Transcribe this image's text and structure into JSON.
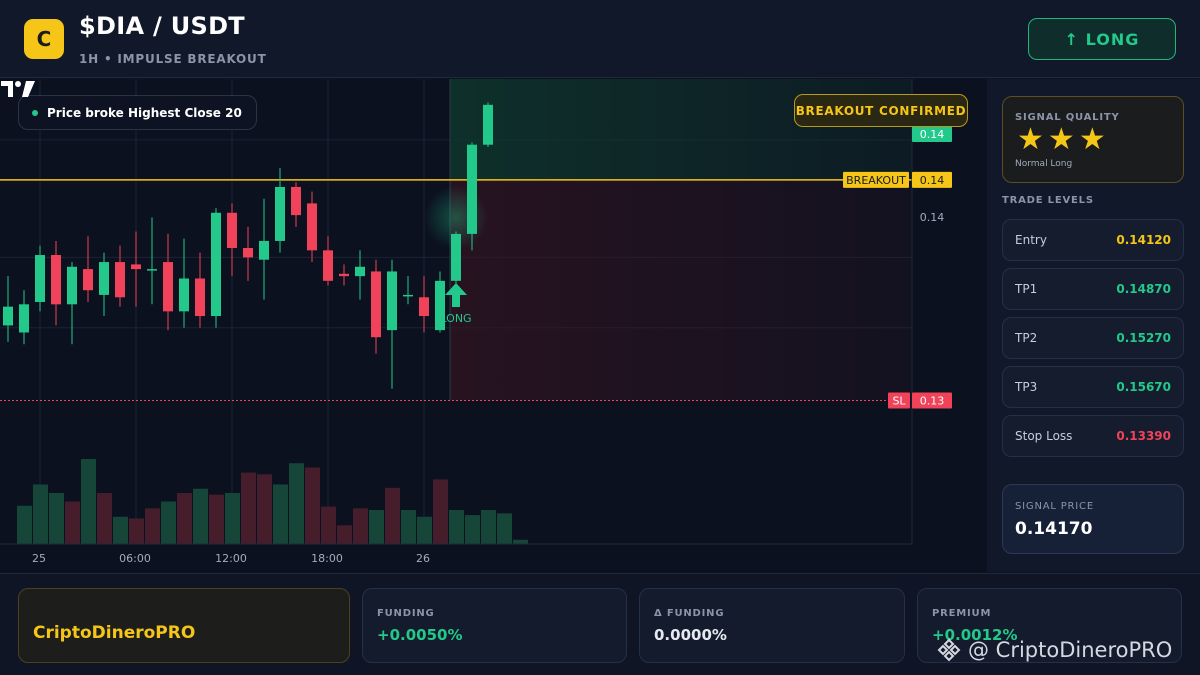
{
  "header": {
    "logo_letter": "C",
    "pair": "$DIA / USDT",
    "subtitle": "1H • IMPULSE BREAKOUT",
    "action_label": "↑ LONG"
  },
  "chart": {
    "note": "Price broke Highest Close 20",
    "badge": "BREAKOUT CONFIRMED",
    "breakout_label": "BREAKOUT",
    "breakout_price": "0.14",
    "sl_label": "SL",
    "sl_price": "0.13",
    "current_price": "0.14",
    "axis_price": "0.14",
    "long_label": "LONG",
    "time_ticks": [
      "25",
      "06:00",
      "12:00",
      "18:00",
      "26"
    ]
  },
  "colors": {
    "bull": "#22c98b",
    "bear": "#f0435a",
    "accent": "#f5c518"
  },
  "chart_data": {
    "type": "candlestick",
    "candles": [
      {
        "o": 0.1371,
        "h": 0.1392,
        "l": 0.1364,
        "c": 0.1379
      },
      {
        "o": 0.1368,
        "h": 0.1386,
        "l": 0.1363,
        "c": 0.138
      },
      {
        "o": 0.1381,
        "h": 0.1405,
        "l": 0.1377,
        "c": 0.1401
      },
      {
        "o": 0.1401,
        "h": 0.1407,
        "l": 0.1371,
        "c": 0.138
      },
      {
        "o": 0.138,
        "h": 0.1398,
        "l": 0.1363,
        "c": 0.1396
      },
      {
        "o": 0.1395,
        "h": 0.1409,
        "l": 0.1381,
        "c": 0.1386
      },
      {
        "o": 0.1384,
        "h": 0.1402,
        "l": 0.1375,
        "c": 0.1398
      },
      {
        "o": 0.1398,
        "h": 0.1405,
        "l": 0.1379,
        "c": 0.1383
      },
      {
        "o": 0.1397,
        "h": 0.1411,
        "l": 0.1379,
        "c": 0.1395
      },
      {
        "o": 0.1395,
        "h": 0.1417,
        "l": 0.138,
        "c": 0.1395
      },
      {
        "o": 0.1398,
        "h": 0.141,
        "l": 0.1369,
        "c": 0.1377
      },
      {
        "o": 0.1377,
        "h": 0.1408,
        "l": 0.137,
        "c": 0.1391
      },
      {
        "o": 0.1391,
        "h": 0.1402,
        "l": 0.137,
        "c": 0.1375
      },
      {
        "o": 0.1375,
        "h": 0.1421,
        "l": 0.137,
        "c": 0.1419
      },
      {
        "o": 0.1419,
        "h": 0.1423,
        "l": 0.1392,
        "c": 0.1404
      },
      {
        "o": 0.1404,
        "h": 0.1413,
        "l": 0.139,
        "c": 0.14
      },
      {
        "o": 0.1399,
        "h": 0.1425,
        "l": 0.1382,
        "c": 0.1407
      },
      {
        "o": 0.1407,
        "h": 0.1438,
        "l": 0.1402,
        "c": 0.143
      },
      {
        "o": 0.143,
        "h": 0.1432,
        "l": 0.1413,
        "c": 0.1418
      },
      {
        "o": 0.1423,
        "h": 0.1428,
        "l": 0.1398,
        "c": 0.1403
      },
      {
        "o": 0.1403,
        "h": 0.1409,
        "l": 0.1388,
        "c": 0.139
      },
      {
        "o": 0.1393,
        "h": 0.1397,
        "l": 0.1388,
        "c": 0.1392
      },
      {
        "o": 0.1392,
        "h": 0.1403,
        "l": 0.1382,
        "c": 0.1396
      },
      {
        "o": 0.1394,
        "h": 0.1399,
        "l": 0.1359,
        "c": 0.1366
      },
      {
        "o": 0.1369,
        "h": 0.1399,
        "l": 0.1344,
        "c": 0.1394
      },
      {
        "o": 0.1384,
        "h": 0.1392,
        "l": 0.138,
        "c": 0.1384
      },
      {
        "o": 0.1383,
        "h": 0.1392,
        "l": 0.1368,
        "c": 0.1375
      },
      {
        "o": 0.1369,
        "h": 0.1394,
        "l": 0.1368,
        "c": 0.139
      },
      {
        "o": 0.139,
        "h": 0.1411,
        "l": 0.1386,
        "c": 0.141
      },
      {
        "o": 0.141,
        "h": 0.1449,
        "l": 0.1403,
        "c": 0.1448
      },
      {
        "o": 0.1448,
        "h": 0.1466,
        "l": 0.1447,
        "c": 0.1465
      }
    ],
    "volumes": [
      0.45,
      0.7,
      0.6,
      0.5,
      1.0,
      0.6,
      0.32,
      0.3,
      0.42,
      0.5,
      0.6,
      0.65,
      0.58,
      0.6,
      0.84,
      0.82,
      0.7,
      0.95,
      0.9,
      0.44,
      0.22,
      0.42,
      0.4,
      0.66,
      0.4,
      0.32,
      0.76,
      0.4,
      0.34,
      0.4,
      0.36,
      0.05
    ],
    "breakout_level": 0.1433,
    "stop_loss": 0.1339,
    "ylim": [
      0.1329,
      0.1476
    ],
    "x_ticks": [
      "25",
      "06:00",
      "12:00",
      "18:00",
      "26"
    ]
  },
  "signal": {
    "quality_label": "SIGNAL QUALITY",
    "stars": 3,
    "quality_sub": "Normal Long",
    "levels_title": "TRADE LEVELS",
    "levels": [
      {
        "name": "Entry",
        "value": "0.14120",
        "color": "#f5c518"
      },
      {
        "name": "TP1",
        "value": "0.14870",
        "color": "#22c98b"
      },
      {
        "name": "TP2",
        "value": "0.15270",
        "color": "#22c98b"
      },
      {
        "name": "TP3",
        "value": "0.15670",
        "color": "#22c98b"
      },
      {
        "name": "Stop Loss",
        "value": "0.13390",
        "color": "#f0435a"
      }
    ],
    "price_label": "SIGNAL PRICE",
    "price_value": "0.14170"
  },
  "footer": {
    "brand": "CriptoDineroPRO",
    "stats": [
      {
        "label": "FUNDING",
        "value": "+0.0050%",
        "color": "#22c98b"
      },
      {
        "label": "Δ FUNDING",
        "value": "0.0000%",
        "color": "#e6e9f0"
      },
      {
        "label": "PREMIUM",
        "value": "+0.0012%",
        "color": "#22c98b"
      }
    ],
    "watermark": "@ CriptoDineroPRO"
  }
}
